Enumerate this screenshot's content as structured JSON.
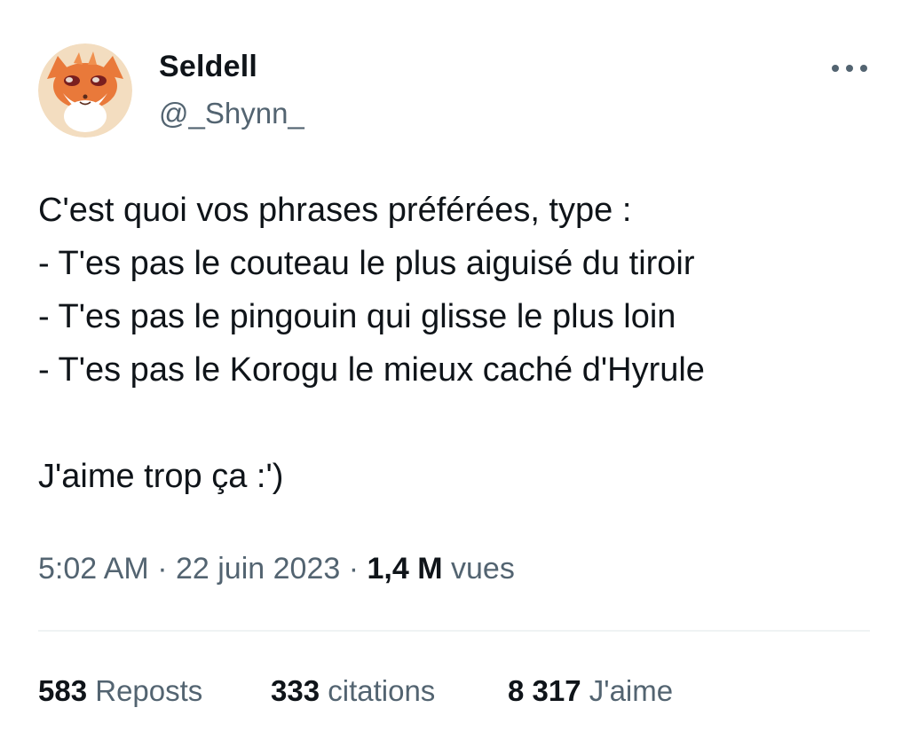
{
  "author": {
    "display_name": "Seldell",
    "handle": "@_Shynn_",
    "avatar_icon": "fox-avatar-icon"
  },
  "menu": {
    "icon": "more-options-icon"
  },
  "tweet": {
    "lines": [
      "C'est quoi vos phrases préférées, type :",
      "- T'es pas le couteau le plus aiguisé du tiroir",
      "- T'es pas le pingouin qui glisse le plus loin",
      "- T'es pas le Korogu le mieux caché d'Hyrule",
      "J'aime trop ça :')"
    ]
  },
  "meta": {
    "time": "5:02 AM",
    "separator": "·",
    "date": "22 juin 2023",
    "views_count": "1,4 M",
    "views_label": "vues"
  },
  "stats": {
    "reposts_count": "583",
    "reposts_label": "Reposts",
    "quotes_count": "333",
    "quotes_label": "citations",
    "likes_count": "8 317",
    "likes_label": "J'aime"
  },
  "colors": {
    "text_primary": "#0f1419",
    "text_secondary": "#536471",
    "divider": "#eff3f4",
    "avatar_bg": "#f3ddc0",
    "fox_orange": "#e9793a"
  }
}
